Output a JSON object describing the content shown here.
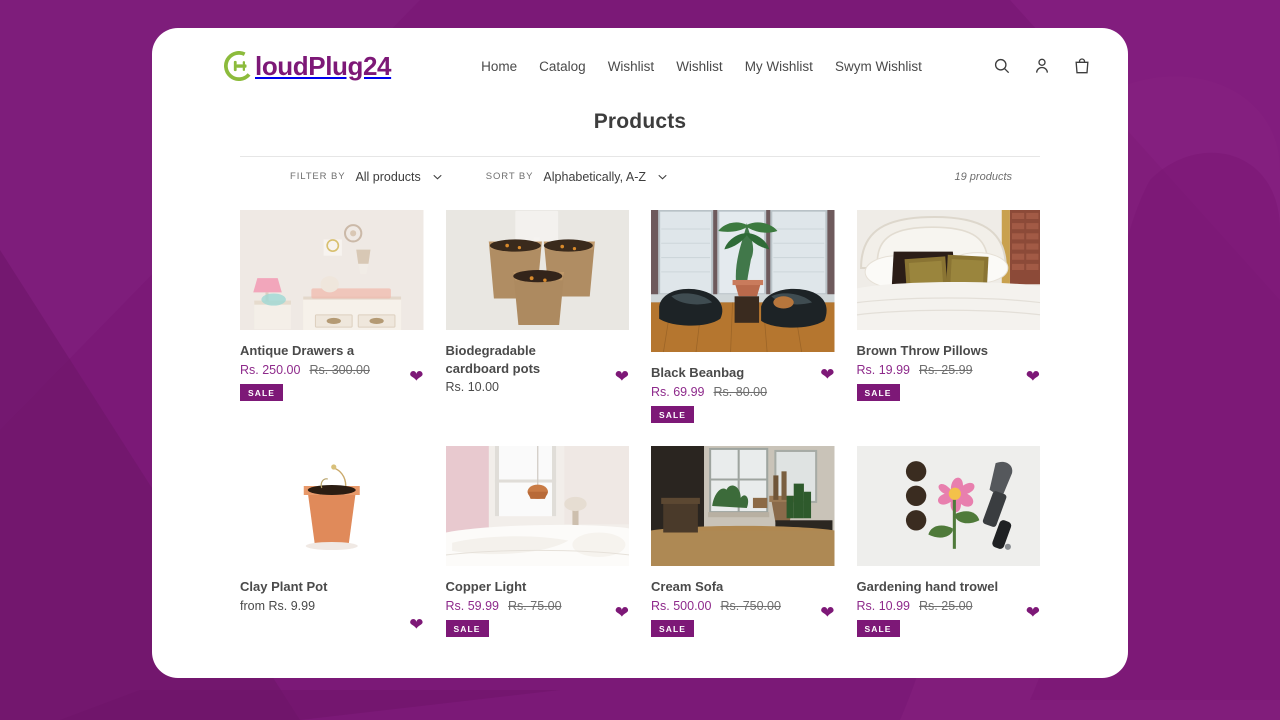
{
  "brand": {
    "logo_icon": "cloud-plug-logo-icon",
    "logo_text": "loudPlug24",
    "accent_purple": "#7d1877",
    "accent_green": "#8cbb3c"
  },
  "header": {
    "nav": [
      {
        "label": "Home"
      },
      {
        "label": "Catalog"
      },
      {
        "label": "Wishlist"
      },
      {
        "label": "Wishlist"
      },
      {
        "label": "My Wishlist"
      },
      {
        "label": "Swym Wishlist"
      }
    ],
    "icons": [
      {
        "name": "search-icon"
      },
      {
        "name": "account-icon"
      },
      {
        "name": "cart-icon"
      }
    ]
  },
  "page": {
    "title": "Products"
  },
  "toolbar": {
    "filter_label": "FILTER BY",
    "filter_value": "All products",
    "sort_label": "SORT BY",
    "sort_value": "Alphabetically, A-Z",
    "product_count": "19 products"
  },
  "products": [
    {
      "title": "Antique Drawers a",
      "price": "Rs. 250.00",
      "compare_price": "Rs. 300.00",
      "badge": "SALE",
      "on_sale": true,
      "image": "nursery-dresser"
    },
    {
      "title": "Biodegradable cardboard pots",
      "price": "Rs. 10.00",
      "compare_price": "",
      "badge": "",
      "on_sale": false,
      "image": "cardboard-pots"
    },
    {
      "title": "Black Beanbag",
      "price": "Rs. 69.99",
      "compare_price": "Rs. 80.00",
      "badge": "SALE",
      "on_sale": true,
      "image": "black-beanbag-room"
    },
    {
      "title": "Brown Throw Pillows",
      "price": "Rs. 19.99",
      "compare_price": "Rs. 25.99",
      "badge": "SALE",
      "on_sale": true,
      "image": "bed-with-pillows"
    },
    {
      "title": "Clay Plant Pot",
      "price": "from Rs. 9.99",
      "compare_price": "",
      "badge": "",
      "on_sale": false,
      "image": "clay-plant-pot"
    },
    {
      "title": "Copper Light",
      "price": "Rs. 59.99",
      "compare_price": "Rs. 75.00",
      "badge": "SALE",
      "on_sale": true,
      "image": "bedroom-copper-light"
    },
    {
      "title": "Cream Sofa",
      "price": "Rs. 500.00",
      "compare_price": "Rs. 750.00",
      "badge": "SALE",
      "on_sale": true,
      "image": "living-room-cactus"
    },
    {
      "title": "Gardening hand trowel",
      "price": "Rs. 10.99",
      "compare_price": "Rs. 25.00",
      "badge": "SALE",
      "on_sale": true,
      "image": "trowel-flower-flatlay"
    }
  ],
  "wishlist_icon": "heart-icon"
}
